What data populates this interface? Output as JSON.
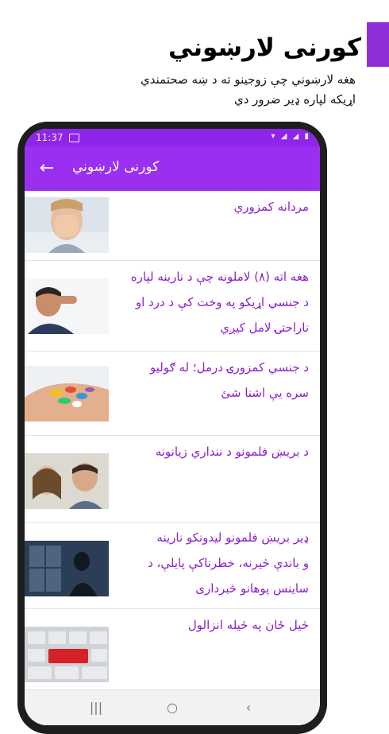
{
  "promo": {
    "title": "كورنى لارښوني",
    "subtitle_line1": "هغه لارښوني چې زوجينو ته د ښه صحتمندي",
    "subtitle_line2": "اړيکه لپاره ډير ضرور دي",
    "accent_color": "#8e2ed8"
  },
  "status_bar": {
    "time": "11:37",
    "icons": "▾ ◢ ◢ ▮"
  },
  "app_bar": {
    "title": "كورنى لارښوني",
    "back_icon": "←",
    "color": "#9b2ff0"
  },
  "list": {
    "text_color": "#8a1fcc",
    "items": [
      {
        "title": "مردانه کمزوري",
        "image": "man-covering-face"
      },
      {
        "title_lines": [
          "هغه اته (۸) لاملونه چې د نارينه لپاره",
          "د جنسي اړيکو په وخت کې د درد او",
          "ناراحتۍ لامل کيږي"
        ],
        "image": "man-stressed"
      },
      {
        "title_lines": [
          "د جنسي کمزورۍ درمل؛ له ګوليو",
          "سره يې اشنا شئ"
        ],
        "image": "pills-in-hand"
      },
      {
        "title": "د بريښ فلمونو د ننداري زيانونه",
        "image": "couple-smiling"
      },
      {
        "title_lines": [
          "ډير بريښ فلمونو ليدونکو نارينه",
          "و باندې څيرنه، خطرناکې پايلې، د",
          "ساينس پوهانو څبرداری"
        ],
        "image": "man-at-window"
      },
      {
        "title": "څيل ځان په څيله انزالول",
        "image": "keyboard-red-key"
      }
    ]
  },
  "nav_bar": {
    "recent": "|||",
    "home": "○",
    "back": "‹"
  }
}
